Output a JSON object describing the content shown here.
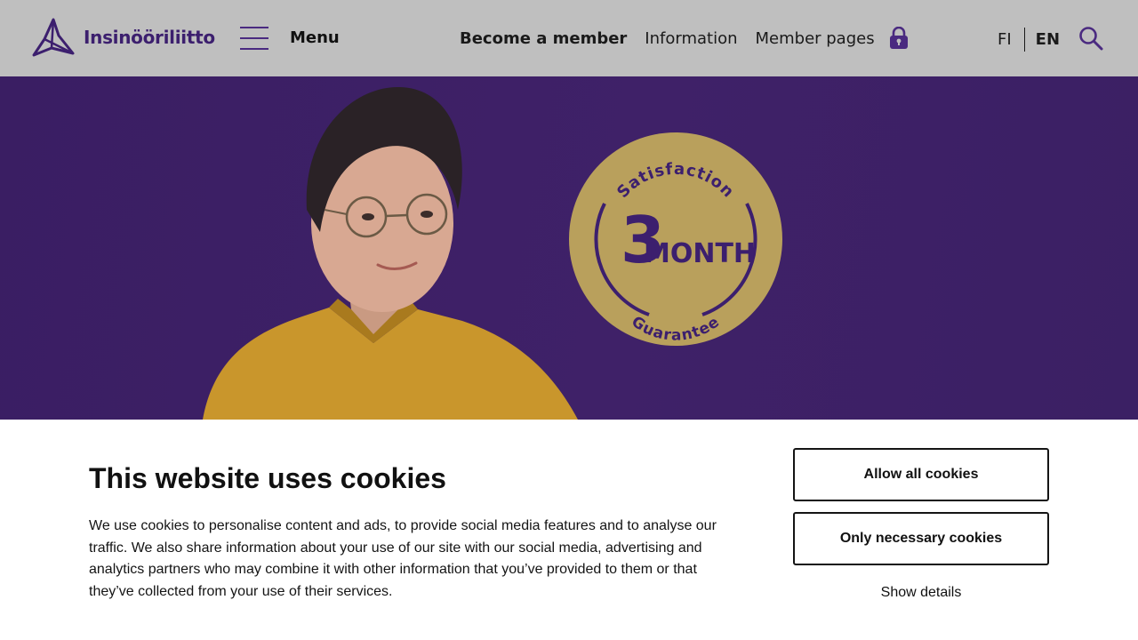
{
  "header": {
    "logo_text": "Insinööriliitto",
    "menu_label": "Menu",
    "nav": {
      "become_member": "Become a member",
      "information": "Information",
      "member_pages": "Member pages"
    },
    "lang": {
      "fi": "FI",
      "en": "EN"
    }
  },
  "hero": {
    "badge": {
      "top_text": "Satisfaction",
      "number": "3",
      "unit": "MONTH",
      "bottom_text": "Guarantee"
    }
  },
  "cookie_banner": {
    "title": "This website uses cookies",
    "text": "We use cookies to personalise content and ads, to provide social media features and to analyse our traffic. We also share information about your use of our site with our social media, advertising and analytics partners who may combine it with other information that you’ve provided to them or that they’ve collected from your use of their services.",
    "allow_all": "Allow all cookies",
    "only_necessary": "Only necessary cookies",
    "show_details": "Show details"
  },
  "colors": {
    "brand_purple": "#3c1f6e",
    "hero_bg": "#3f2168",
    "badge_gold": "#b9a05c",
    "header_bg": "#bfbfbf"
  },
  "icons": [
    "logo-mark-icon",
    "hamburger-icon",
    "lock-icon",
    "search-icon"
  ]
}
